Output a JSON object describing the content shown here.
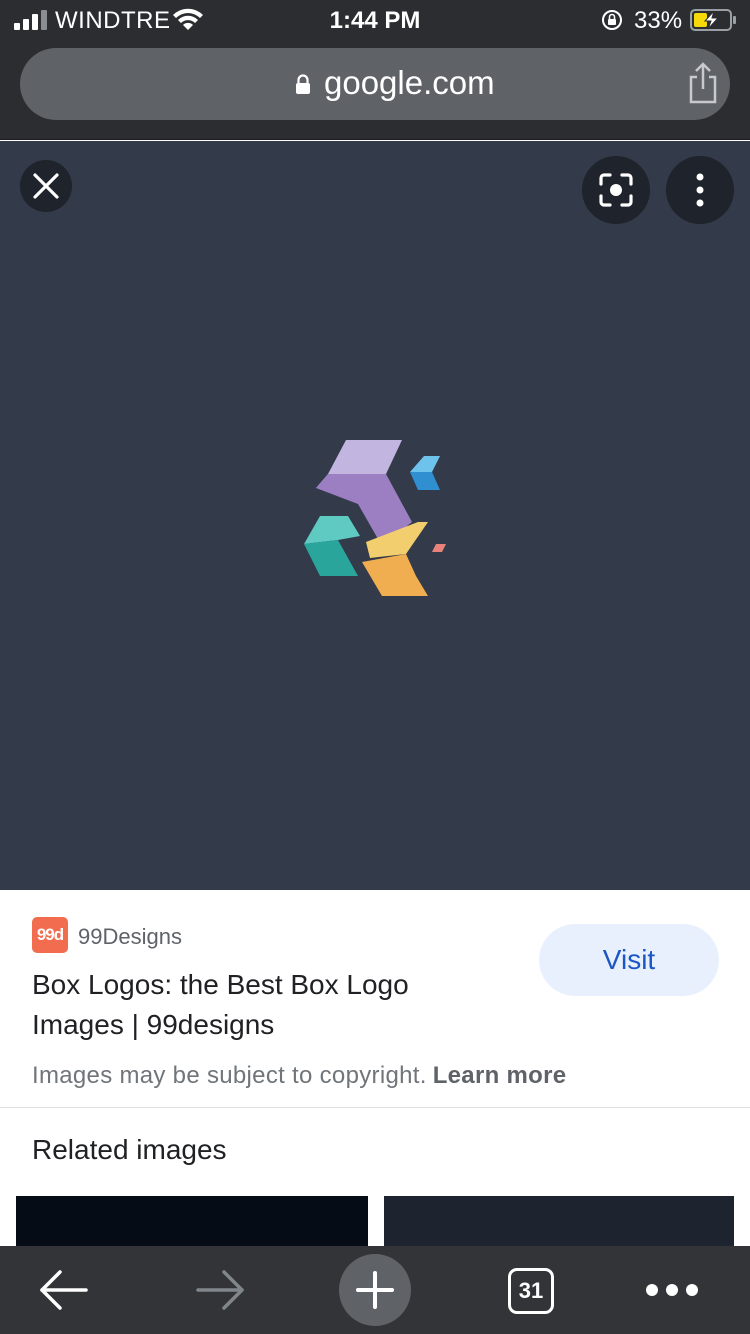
{
  "status_bar": {
    "carrier": "WINDTRE",
    "time": "1:44 PM",
    "battery_percent": "33%",
    "icons": [
      "signal-icon",
      "wifi-icon",
      "rotation-lock-icon",
      "battery-charging-icon"
    ]
  },
  "url_bar": {
    "domain": "google.com",
    "icons": [
      "lock-icon",
      "share-icon"
    ]
  },
  "viewer": {
    "icons": [
      "close-icon",
      "lens-icon",
      "more-vert-icon"
    ],
    "background": "#333a49"
  },
  "result": {
    "favicon_text": "99d",
    "source": "99Designs",
    "title": "Box Logos: the Best Box Logo Images | 99designs",
    "visit_label": "Visit",
    "copyright_text": "Images may be subject to copyright.",
    "learn_more": "Learn more"
  },
  "related": {
    "heading": "Related images"
  },
  "toolbar": {
    "tab_count": "31",
    "icons": [
      "back-arrow-icon",
      "forward-arrow-icon",
      "plus-icon",
      "tabs-icon",
      "more-horiz-icon"
    ]
  },
  "colors": {
    "accent": "#1a56c4",
    "visit_bg": "#e8f0fe",
    "favicon": "#f26d4f"
  }
}
